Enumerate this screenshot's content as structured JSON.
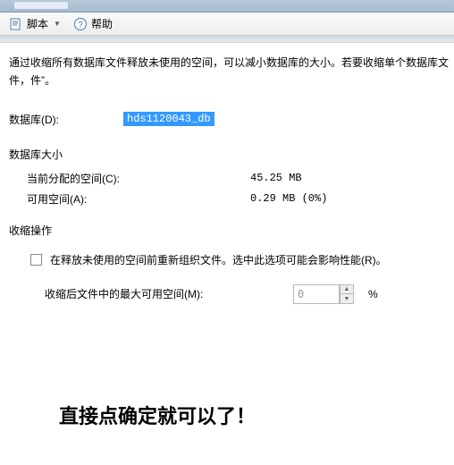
{
  "toolbar": {
    "script_label": "脚本",
    "help_label": "帮助"
  },
  "description": "通过收缩所有数据库文件释放未使用的空间，可以减小数据库的大小。若要收缩单个数据库文件，件”。",
  "db": {
    "label": "数据库(D):",
    "value": "hds1120043_db"
  },
  "size_section": {
    "title": "数据库大小",
    "allocated_label": "当前分配的空间(C):",
    "allocated_value": "45.25 MB",
    "available_label": "可用空间(A):",
    "available_value": "0.29 MB (0%)"
  },
  "shrink_section": {
    "title": "收缩操作",
    "checkbox_label": "在释放未使用的空间前重新组织文件。选中此选项可能会影响性能(R)。",
    "max_label": "收缩后文件中的最大可用空间(M):",
    "max_value": "0",
    "pct": "%"
  },
  "note": "直接点确定就可以了！"
}
